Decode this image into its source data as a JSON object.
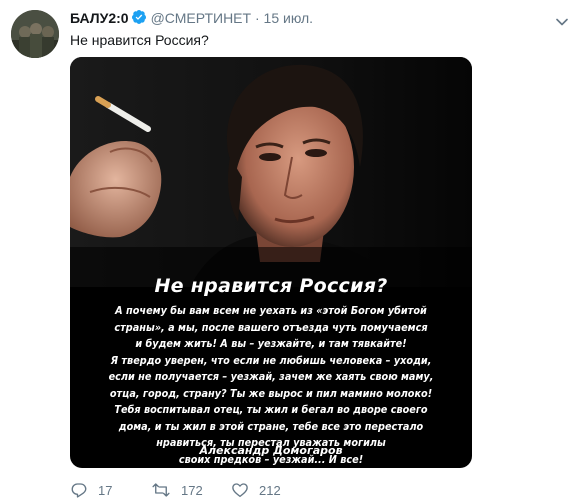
{
  "tweet": {
    "author_name": "БАЛУ2:0",
    "handle": "@СМЕРТИНЕТ",
    "separator": "·",
    "date": "15 июл.",
    "text": "Не нравится Россия?"
  },
  "media": {
    "title": "Не нравится Россия?",
    "lines": [
      "А почему бы вам всем не уехать из «этой Богом убитой",
      "страны», а мы, после вашего отъезда чуть помучаемся",
      "и будем жить! А вы – уезжайте, и там тявкайте!",
      "Я твердо уверен, что если не любишь человека – уходи,",
      "если не получается – уезжай, зачем же хаять свою маму,",
      "отца, город, страну? Ты же вырос и пил мамино молоко!",
      "Тебя воспитывал отец, ты жил и бегал во дворе своего",
      "дома, и ты жил в этой стране, тебе все это перестало",
      "нравиться, ты перестал уважать могилы",
      "своих предков – уезжай... И все!"
    ],
    "author": "Александр Домогаров"
  },
  "actions": {
    "replies": "17",
    "retweets": "172",
    "likes": "212"
  },
  "colors": {
    "verified": "#1da1f2",
    "secondary_text": "#657786"
  },
  "icons": [
    "verified-icon",
    "caret-down-icon",
    "reply-icon",
    "retweet-icon",
    "like-icon"
  ]
}
